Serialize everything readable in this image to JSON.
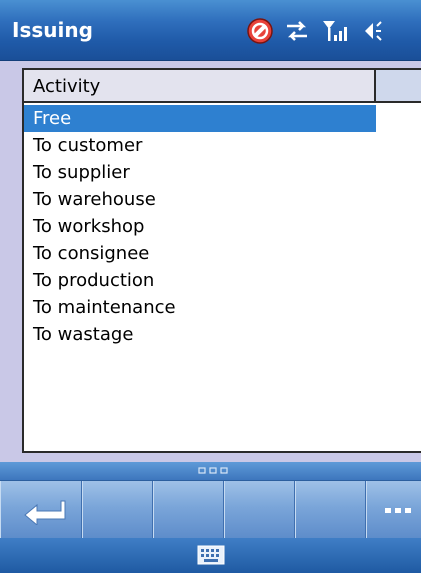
{
  "titlebar": {
    "title": "Issuing",
    "icons": [
      "sync-error-icon",
      "connectivity-arrows-icon",
      "signal-strength-icon",
      "speaker-icon"
    ]
  },
  "list": {
    "column_header": "Activity",
    "items": [
      "Free",
      "To customer",
      "To supplier",
      "To warehouse",
      "To workshop",
      "To consignee",
      "To production",
      "To maintenance",
      "To wastage"
    ],
    "selected_index": 0
  },
  "command_bar": {
    "buttons": [
      "back-icon",
      "",
      "",
      "",
      "",
      "more-icon"
    ]
  },
  "colors": {
    "titlebar": "#1f5aa8",
    "selection": "#2e80d0",
    "background": "#c9c8e7"
  }
}
